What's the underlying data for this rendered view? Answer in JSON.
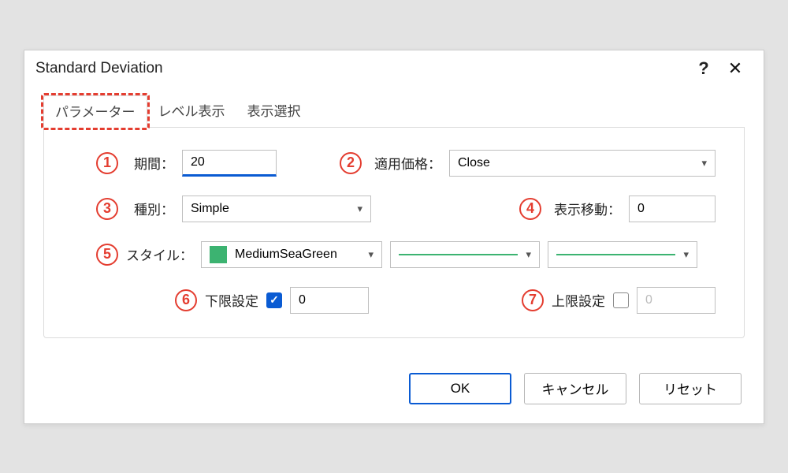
{
  "title": "Standard Deviation",
  "tabs": {
    "t0": "パラメーター",
    "t1": "レベル表示",
    "t2": "表示選択"
  },
  "annot": {
    "n1": "1",
    "n2": "2",
    "n3": "3",
    "n4": "4",
    "n5": "5",
    "n6": "6",
    "n7": "7"
  },
  "fields": {
    "period_label": "期間：",
    "period_value": "20",
    "apply_label": "適用価格：",
    "apply_value": "Close",
    "method_label": "種別：",
    "method_value": "Simple",
    "shift_label": "表示移動：",
    "shift_value": "0",
    "style_label": "スタイル：",
    "style_color_name": "MediumSeaGreen",
    "lower_label": "下限設定",
    "lower_value": "0",
    "upper_label": "上限設定",
    "upper_value": "0"
  },
  "buttons": {
    "ok": "OK",
    "cancel": "キャンセル",
    "reset": "リセット"
  },
  "colors": {
    "accent": "#0a5bd3",
    "annot": "#e43d30",
    "swatch": "#3cb371"
  }
}
